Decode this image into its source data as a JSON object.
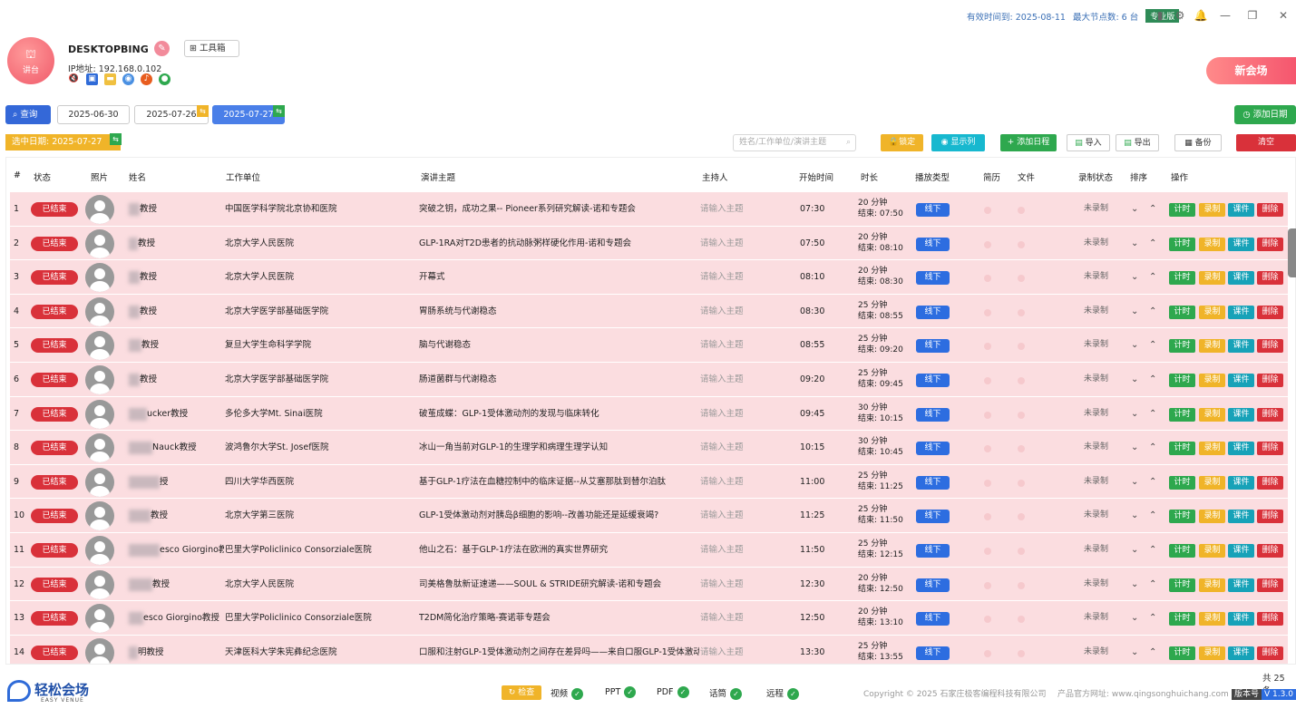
{
  "topbar": {
    "expiry": "有效时间到: 2025-08-11",
    "max_nodes": "最大节点数: 6 台",
    "edition": "专业版"
  },
  "header": {
    "avatar_label": "讲台",
    "hostname": "DESKTOPBING",
    "toolbox_label": "工具箱",
    "ip": "IP地址: 192.168.0.102",
    "new_venue": "新会场"
  },
  "dates": {
    "query_label": "查询",
    "tabs": [
      {
        "label": "2025-06-30",
        "active": false
      },
      {
        "label": "2025-07-26",
        "active": false,
        "badge": "⇆"
      },
      {
        "label": "2025-07-27",
        "active": true,
        "badge": "⇆"
      }
    ],
    "add_date": "添加日期",
    "selected_date": "选中日期:   2025-07-27"
  },
  "toolbar": {
    "search_placeholder": "姓名/工作单位/演讲主题",
    "lock": "锁定",
    "show_columns": "显示列",
    "add_schedule": "添加日程",
    "import": "导入",
    "export": "导出",
    "backup": "备份",
    "clear": "清空"
  },
  "table": {
    "headers": {
      "num": "#",
      "status": "状态",
      "photo": "照片",
      "name": "姓名",
      "org": "工作单位",
      "topic": "演讲主题",
      "host": "主持人",
      "start": "开始时间",
      "duration": "时长",
      "ptype": "播放类型",
      "cv": "简历",
      "file": "文件",
      "record": "录制状态",
      "sort": "排序",
      "ops": "操作"
    },
    "status_label": "已结束",
    "host_placeholder": "请输入主题",
    "ptype_label": "线下",
    "record_label": "未录制",
    "op_labels": {
      "timer": "计时",
      "record": "录制",
      "courseware": "课件",
      "delete": "删除"
    },
    "rows": [
      {
        "num": "1",
        "name": "教授",
        "org": "中国医学科学院北京协和医院",
        "topic": "突破之钥，成功之果-- Pioneer系列研究解读-诺和专题会",
        "start": "07:30",
        "dur": "20 分钟",
        "end": "结束: 07:50"
      },
      {
        "num": "2",
        "name": "教授",
        "org": "北京大学人民医院",
        "topic": "GLP-1RA对T2D患者的抗动脉粥样硬化作用-诺和专题会",
        "start": "07:50",
        "dur": "20 分钟",
        "end": "结束: 08:10"
      },
      {
        "num": "3",
        "name": "教授",
        "org": "北京大学人民医院",
        "topic": "开幕式",
        "start": "08:10",
        "dur": "20 分钟",
        "end": "结束: 08:30"
      },
      {
        "num": "4",
        "name": "教授",
        "org": "北京大学医学部基础医学院",
        "topic": "胃肠系统与代谢稳态",
        "start": "08:30",
        "dur": "25 分钟",
        "end": "结束: 08:55"
      },
      {
        "num": "5",
        "name": "教授",
        "org": "复旦大学生命科学学院",
        "topic": "脑与代谢稳态",
        "start": "08:55",
        "dur": "25 分钟",
        "end": "结束: 09:20"
      },
      {
        "num": "6",
        "name": "教授",
        "org": "北京大学医学部基础医学院",
        "topic": "肠道菌群与代谢稳态",
        "start": "09:20",
        "dur": "25 分钟",
        "end": "结束: 09:45"
      },
      {
        "num": "7",
        "name": "ucker教授",
        "org": "多伦多大学Mt. Sinai医院",
        "topic": "破茧成蝶：GLP-1受体激动剂的发现与临床转化",
        "start": "09:45",
        "dur": "30 分钟",
        "end": "结束: 10:15"
      },
      {
        "num": "8",
        "name": "Nauck教授",
        "org": "波鸿鲁尔大学St. Josef医院",
        "topic": "冰山一角当前对GLP-1的生理学和病理生理学认知",
        "start": "10:15",
        "dur": "30 分钟",
        "end": "结束: 10:45"
      },
      {
        "num": "9",
        "name": "授",
        "org": "四川大学华西医院",
        "topic": "基于GLP-1疗法在血糖控制中的临床证据--从艾塞那肽到替尔泊肽",
        "start": "11:00",
        "dur": "25 分钟",
        "end": "结束: 11:25"
      },
      {
        "num": "10",
        "name": "教授",
        "org": "北京大学第三医院",
        "topic": "GLP-1受体激动剂对胰岛β细胞的影响--改善功能还是延缓衰竭?",
        "start": "11:25",
        "dur": "25 分钟",
        "end": "结束: 11:50"
      },
      {
        "num": "11",
        "name": "esco Giorgino教授",
        "org": "巴里大学Policlinico Consorziale医院",
        "topic": "他山之石：基于GLP-1疗法在欧洲的真实世界研究",
        "start": "11:50",
        "dur": "25 分钟",
        "end": "结束: 12:15"
      },
      {
        "num": "12",
        "name": "教授",
        "org": "北京大学人民医院",
        "topic": "司美格鲁肽新证速递——SOUL & STRIDE研究解读-诺和专题会",
        "start": "12:30",
        "dur": "20 分钟",
        "end": "结束: 12:50"
      },
      {
        "num": "13",
        "name": "esco Giorgino教授",
        "org": "巴里大学Policlinico Consorziale医院",
        "topic": "T2DM简化治疗策略-赛诺菲专题会",
        "start": "12:50",
        "dur": "20 分钟",
        "end": "结束: 13:10"
      },
      {
        "num": "14",
        "name": "明教授",
        "org": "天津医科大学朱宪彝纪念医院",
        "topic": "口服和注射GLP-1受体激动剂之间存在差异吗——来自口服GLP-1受体激动剂",
        "start": "13:30",
        "dur": "25 分钟",
        "end": "结束: 13:55"
      }
    ]
  },
  "footer": {
    "total": "共 25 条",
    "logo_name": "轻松会场",
    "logo_sub": "EASY VENUE",
    "check": "检查",
    "checks": [
      "视频",
      "PPT",
      "PDF",
      "话筒",
      "远程"
    ],
    "copyright": "Copyright © 2025 石家庄极客编程科技有限公司",
    "site": "产品官方网址: www.qingsonghuichang.com",
    "version_key": "版本号",
    "version": "V 1.3.0"
  },
  "colors": {
    "accent": "#3468d8",
    "row_bg": "#fbdde0",
    "status": "#d9313a",
    "green": "#2ea84e",
    "orange": "#f0b429",
    "teal": "#17a2b8"
  }
}
